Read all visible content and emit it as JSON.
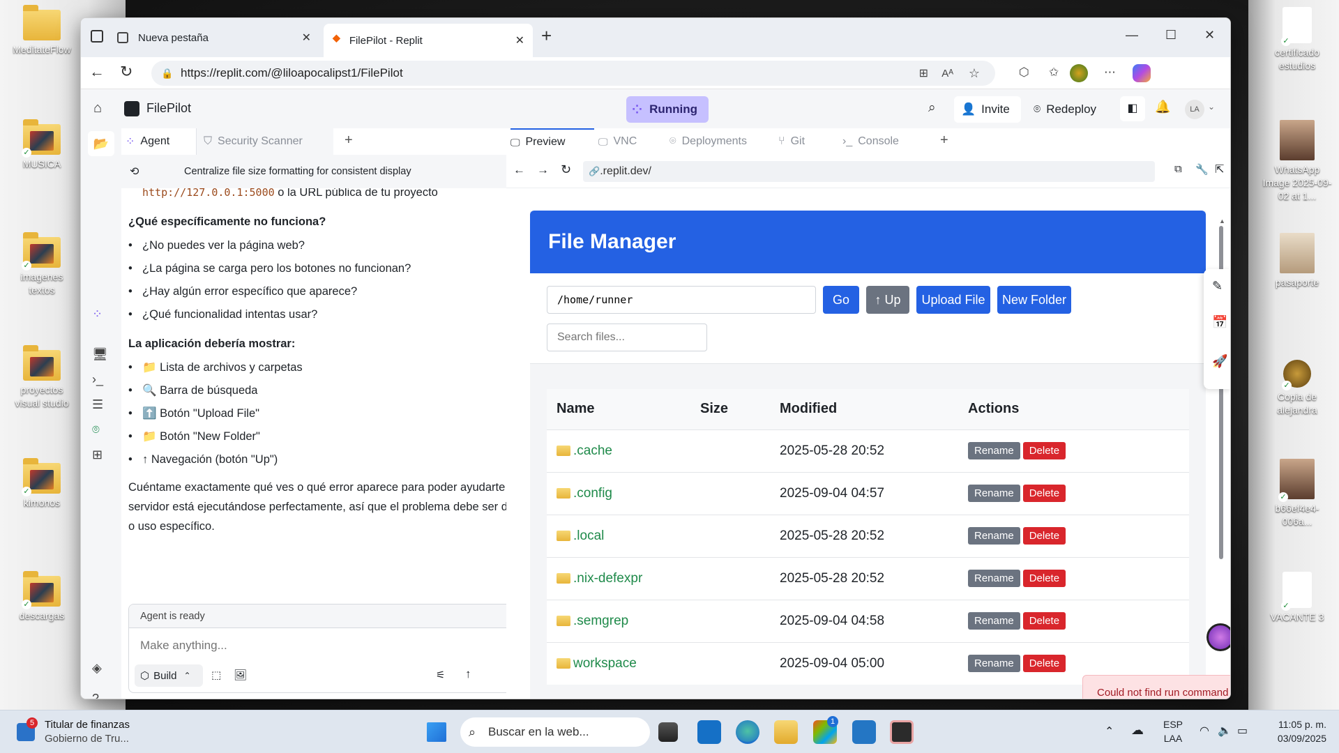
{
  "desktop": {
    "left_icons": [
      "MeditateFlow",
      "MUSICA",
      "imagenes textos",
      "proyectos visual studio",
      "kimonos",
      "descargas"
    ],
    "right_icons": [
      "certificado estudios",
      "WhatsApp Image 2025-09-02 at 1...",
      "pasaporte",
      "Copia de alejandra",
      "b66ef4e4-006a...",
      "VACANTE 3"
    ]
  },
  "browser": {
    "tabs": [
      "Nueva pestaña",
      "FilePilot - Replit"
    ],
    "url": "https://replit.com/@liloapocalipst1/FilePilot"
  },
  "replit": {
    "project": "FilePilot",
    "status": "Running",
    "invite": "Invite",
    "redeploy": "Redeploy",
    "avatar": "LA",
    "left_tabs": [
      "Agent",
      "Security Scanner"
    ],
    "right_tabs": [
      "Preview",
      "VNC",
      "Deployments",
      "Git",
      "Console"
    ],
    "thread_title": "Centralize file size formatting for consistent display",
    "preview_url": ".replit.dev/",
    "toast": "Could not find run command"
  },
  "chat": {
    "top_code": "http://127.0.0.1:5000",
    "top_rest": " o la URL pública de tu proyecto",
    "q_heading": "¿Qué específicamente no funciona?",
    "q_items": [
      "¿No puedes ver la página web?",
      "¿La página se carga pero los botones no funcionan?",
      "¿Hay algún error específico que aparece?",
      "¿Qué funcionalidad intentas usar?"
    ],
    "a_heading": "La aplicación debería mostrar:",
    "a_items": [
      "📁 Lista de archivos y carpetas",
      "🔍 Barra de búsqueda",
      "⬆️ Botón \"Upload File\"",
      "📁 Botón \"New Folder\"",
      "↑ Navegación (botón \"Up\")"
    ],
    "closing": "Cuéntame exactamente qué ves o qué error aparece para poder ayudarte mejor. El servidor está ejecutándose perfectamente, así que el problema debe ser de acceso o uso específico.",
    "agent_status": "Agent is ready",
    "input_placeholder": "Make anything...",
    "build_label": "Build"
  },
  "file_manager": {
    "title": "File Manager",
    "path": "/home/runner",
    "go": "Go",
    "up": "↑ Up",
    "upload": "Upload File",
    "new_folder": "New Folder",
    "search_placeholder": "Search files...",
    "columns": [
      "Name",
      "Size",
      "Modified",
      "Actions"
    ],
    "rows": [
      {
        "name": ".cache",
        "size": "",
        "modified": "2025-05-28 20:52"
      },
      {
        "name": ".config",
        "size": "",
        "modified": "2025-09-04 04:57"
      },
      {
        "name": ".local",
        "size": "",
        "modified": "2025-05-28 20:52"
      },
      {
        "name": ".nix-defexpr",
        "size": "",
        "modified": "2025-05-28 20:52"
      },
      {
        "name": ".semgrep",
        "size": "",
        "modified": "2025-09-04 04:58"
      },
      {
        "name": "workspace",
        "size": "",
        "modified": "2025-09-04 05:00"
      }
    ],
    "rename": "Rename",
    "delete": "Delete"
  },
  "taskbar": {
    "news_title": "Titular de finanzas",
    "news_sub": "Gobierno de Tru...",
    "news_badge": "5",
    "search": "Buscar en la web...",
    "store_badge": "1",
    "lang1": "ESP",
    "lang2": "LAA",
    "time": "11:05 p. m.",
    "date": "03/09/2025"
  }
}
